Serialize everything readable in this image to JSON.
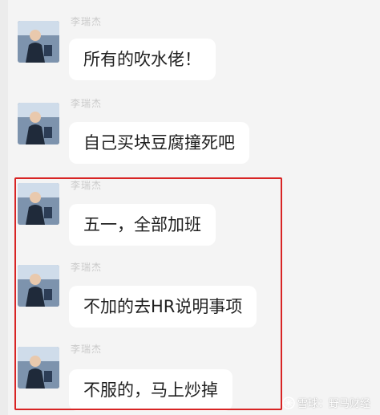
{
  "messages": [
    {
      "sender": "李瑞杰",
      "text": "所有的吹水佬！"
    },
    {
      "sender": "李瑞杰",
      "text": "自己买块豆腐撞死吧"
    },
    {
      "sender": "李瑞杰",
      "text": "五一，全部加班"
    },
    {
      "sender": "李瑞杰",
      "text": "不加的去HR说明事项"
    },
    {
      "sender": "李瑞杰",
      "text": "不服的，马上炒掉"
    }
  ],
  "watermark": {
    "text": "雪球：野马财经",
    "icon": "snowball-icon"
  },
  "colors": {
    "background": "#f4f4f4",
    "bubble": "#ffffff",
    "highlight_border": "#d82424"
  }
}
